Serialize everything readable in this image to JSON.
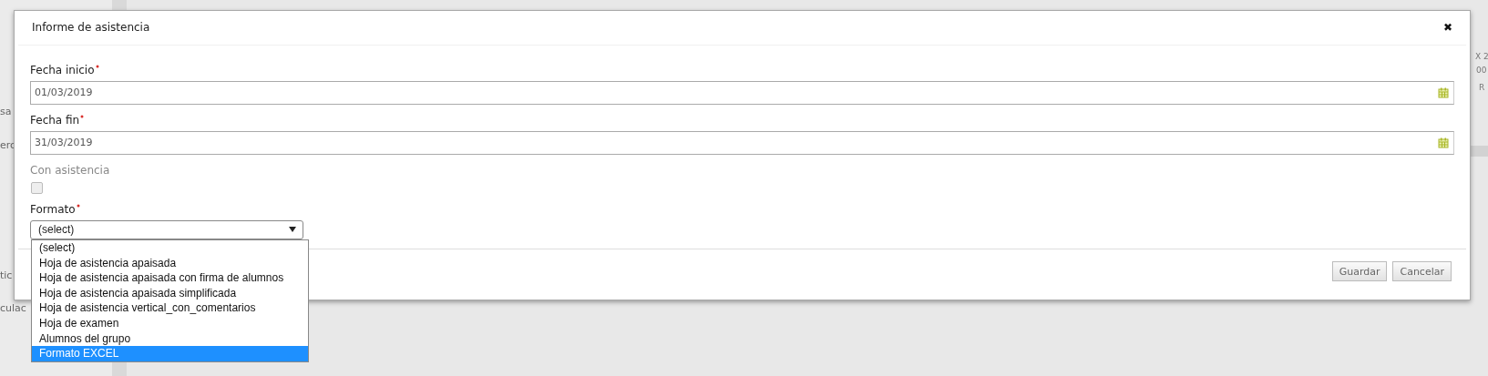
{
  "background": {
    "left_fragments": [
      {
        "text": "sa"
      },
      {
        "text": "erc"
      },
      {
        "text": "tic"
      },
      {
        "text": "culac"
      }
    ],
    "right_fragments": [
      {
        "text": "X 2"
      },
      {
        "text": "00"
      },
      {
        "text": "R"
      }
    ]
  },
  "dialog": {
    "title": "Informe de asistencia",
    "close": "✖",
    "fields": [
      {
        "kind": "date",
        "label": "Fecha inicio",
        "required": true,
        "value": "01/03/2019"
      },
      {
        "kind": "date",
        "label": "Fecha fin",
        "required": true,
        "value": "31/03/2019"
      },
      {
        "kind": "checkbox",
        "label": "Con asistencia",
        "required": false,
        "checked": false
      },
      {
        "kind": "select",
        "label": "Formato",
        "required": true,
        "value": "(select)",
        "expanded": true,
        "options": [
          {
            "label": "(select)",
            "highlighted": false
          },
          {
            "label": "Hoja de asistencia apaisada",
            "highlighted": false
          },
          {
            "label": "Hoja de asistencia apaisada con firma de alumnos",
            "highlighted": false
          },
          {
            "label": "Hoja de asistencia apaisada simplificada",
            "highlighted": false
          },
          {
            "label": "Hoja de asistencia vertical_con_comentarios",
            "highlighted": false
          },
          {
            "label": "Hoja de examen",
            "highlighted": false
          },
          {
            "label": "Alumnos del grupo",
            "highlighted": false
          },
          {
            "label": "Formato EXCEL",
            "highlighted": true
          }
        ]
      }
    ],
    "buttons": [
      {
        "label": "Guardar"
      },
      {
        "label": "Cancelar"
      }
    ]
  }
}
